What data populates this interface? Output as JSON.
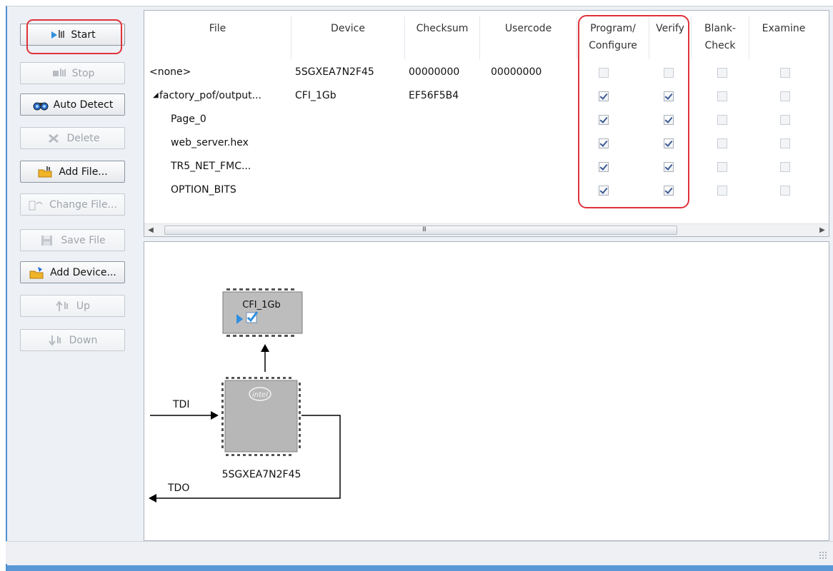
{
  "toolbar": {
    "start": "Start",
    "stop": "Stop",
    "auto_detect": "Auto Detect",
    "delete": "Delete",
    "add_file": "Add File...",
    "change_file": "Change File...",
    "save_file": "Save File",
    "add_device": "Add Device...",
    "up": "Up",
    "down": "Down"
  },
  "table": {
    "headers": {
      "file": "File",
      "device": "Device",
      "checksum": "Checksum",
      "usercode": "Usercode",
      "program_line1": "Program/",
      "program_line2": "Configure",
      "verify": "Verify",
      "blank_line1": "Blank-",
      "blank_line2": "Check",
      "examine": "Examine"
    },
    "rows": [
      {
        "file": "<none>",
        "device": "5SGXEA7N2F45",
        "checksum": "00000000",
        "usercode": "00000000",
        "program": false,
        "verify": false,
        "blank": false,
        "examine": false
      },
      {
        "file": "factory_pof/output...",
        "device": "CFI_1Gb",
        "checksum": "EF56F5B4",
        "usercode": "",
        "program": true,
        "verify": true,
        "blank": false,
        "examine": false
      },
      {
        "file": "Page_0",
        "device": "",
        "checksum": "",
        "usercode": "",
        "program": true,
        "verify": true,
        "blank": false,
        "examine": false
      },
      {
        "file": "web_server.hex",
        "device": "",
        "checksum": "",
        "usercode": "",
        "program": true,
        "verify": true,
        "blank": false,
        "examine": false
      },
      {
        "file": "TR5_NET_FMC...",
        "device": "",
        "checksum": "",
        "usercode": "",
        "program": true,
        "verify": true,
        "blank": false,
        "examine": false
      },
      {
        "file": "OPTION_BITS",
        "device": "",
        "checksum": "",
        "usercode": "",
        "program": true,
        "verify": true,
        "blank": false,
        "examine": false
      }
    ],
    "scroll_grip": "III"
  },
  "chain": {
    "flash_label": "CFI_1Gb",
    "fpga_label": "5SGXEA7N2F45",
    "fpga_logo": "intel",
    "tdi": "TDI",
    "tdo": "TDO"
  },
  "colors": {
    "highlight_ring": "#e0313a",
    "chip_fill": "#b7b7b7",
    "accent_blue": "#2f8fe0"
  }
}
